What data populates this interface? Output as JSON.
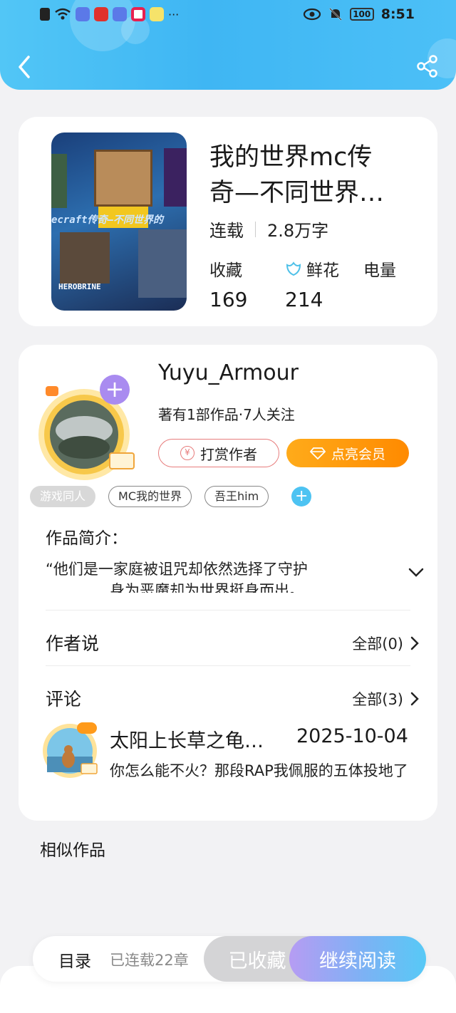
{
  "status_bar": {
    "time": "8:51",
    "battery": "100"
  },
  "book": {
    "cover_text": "ecraft传奇—不同世界的",
    "cover_badge": "HEROBRINE",
    "title_line1": "我的世界mc传",
    "title_line2": "奇—不同世界…",
    "status": "连载",
    "word_count": "2.8万字",
    "stats": [
      {
        "label": "收藏",
        "value": "169"
      },
      {
        "label": "鲜花",
        "value": "214"
      },
      {
        "label": "电量",
        "value": ""
      }
    ]
  },
  "author": {
    "name": "Yuyu_Armour",
    "subtitle": "著有1部作品·7人关注",
    "tip_button": "打赏作者",
    "vip_button": "点亮会员"
  },
  "tags": [
    "游戏同人",
    "MC我的世界",
    "吾王him"
  ],
  "intro": {
    "title": "作品简介：",
    "line1": "“他们是一家庭被诅咒却依然选择了守护",
    "line2": "身为恶魔却为世界挺身而出。"
  },
  "author_says": {
    "title": "作者说",
    "link": "全部(0)"
  },
  "comments": {
    "title": "评论",
    "link": "全部(3)",
    "items": [
      {
        "name": "太阳上长草之龟…",
        "date": "2025-10-04",
        "text": "你怎么能不火？那段RAP我佩服的五体投地了"
      }
    ]
  },
  "similar_title": "相似作品",
  "bottom_bar": {
    "toc": "目录",
    "chapters": "已连载22章",
    "favorited": "已收藏",
    "continue": "继续阅读"
  },
  "colors": {
    "header": "#3fb6f3",
    "vip": "#ff9a0d",
    "accent_blue": "#4dc3f2"
  }
}
